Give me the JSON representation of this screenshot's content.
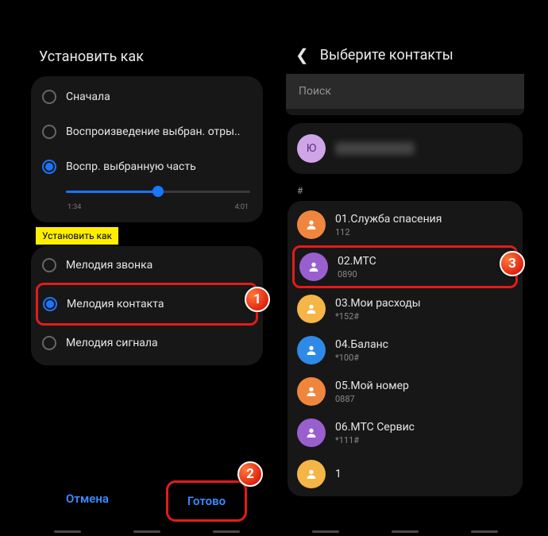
{
  "left": {
    "title": "Установить как",
    "play": {
      "opt1": "Сначала",
      "opt2": "Воспроизведение выбран. отры..",
      "opt3": "Воспр. выбранную часть",
      "t_start": "1:34",
      "t_end": "4:01"
    },
    "badge": "Установить как",
    "set": {
      "opt1": "Мелодия звонка",
      "opt2": "Мелодия контакта",
      "opt3": "Мелодия сигнала"
    },
    "cancel": "Отмена",
    "done": "Готово"
  },
  "right": {
    "title": "Выберите контакты",
    "search_ph": "Поиск",
    "top_avatar_letter": "Ю",
    "section": "#",
    "contacts": [
      {
        "name": "01.Служба спасения",
        "num": "112",
        "color": "#f0863e"
      },
      {
        "name": "02.МТС",
        "num": "0890",
        "color": "#9a5fcf"
      },
      {
        "name": "03.Мои расходы",
        "num": "*152#",
        "color": "#f5b547"
      },
      {
        "name": "04.Баланс",
        "num": "*100#",
        "color": "#2e8ae6"
      },
      {
        "name": "05.Мой номер",
        "num": "0887",
        "color": "#f0863e"
      },
      {
        "name": "06.МТС Сервис",
        "num": "*111#",
        "color": "#9a5fcf"
      },
      {
        "name": "1",
        "num": "",
        "color": "#f5b547"
      }
    ]
  },
  "steps": {
    "s1": "1",
    "s2": "2",
    "s3": "3"
  }
}
